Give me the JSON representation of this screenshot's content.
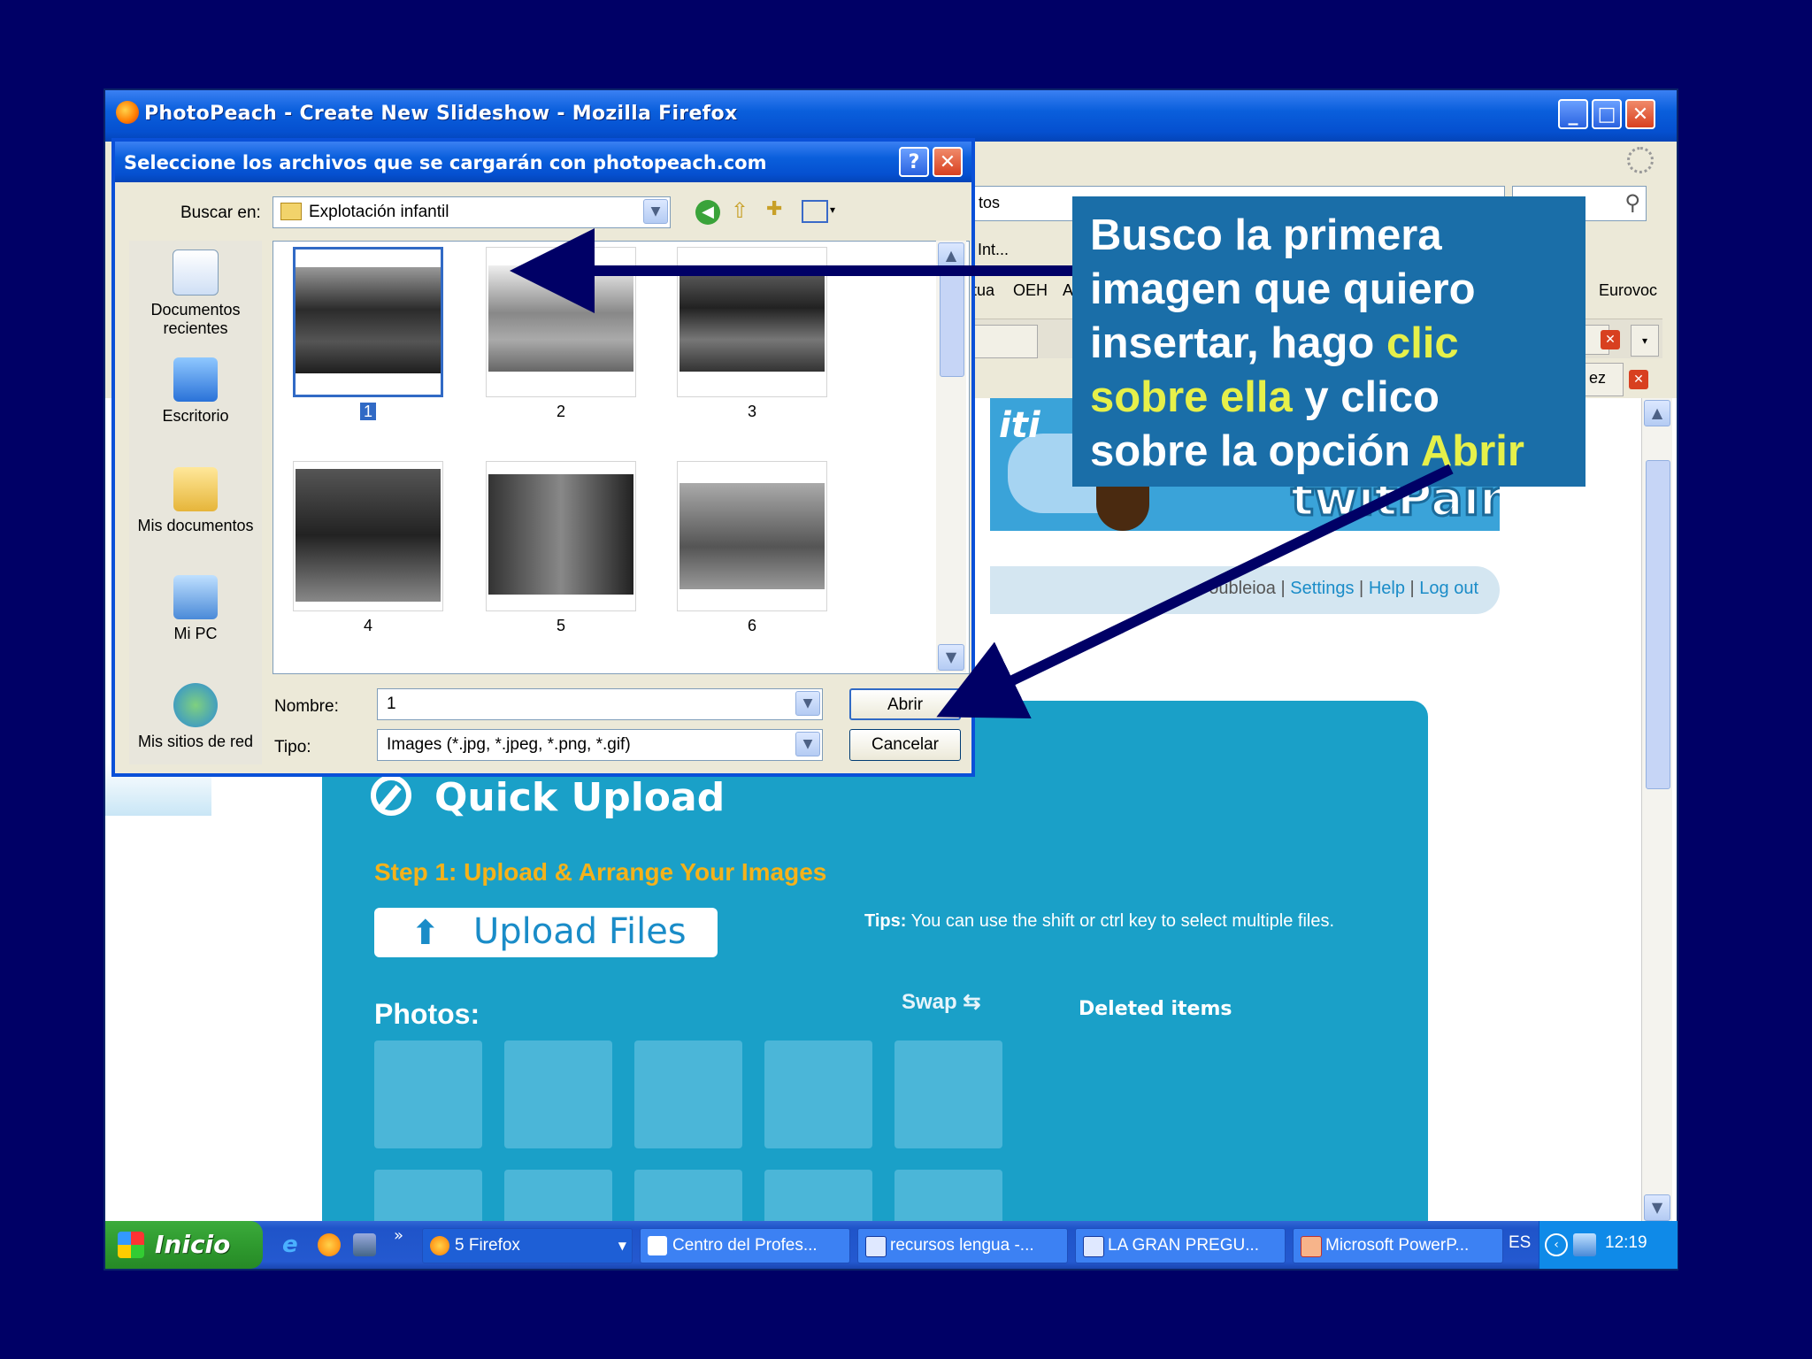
{
  "firefox": {
    "title": "PhotoPeach - Create New Slideshow - Mozilla Firefox",
    "bookmark_partial_1": "tos",
    "bookmark_partial_2": "Int...",
    "bookmark_partial_3": "tua",
    "bookmark_partial_4": "OEH",
    "bookmark_partial_5": "A",
    "bookmark_eurovoc": "Eurovoc",
    "tab_partial": "ez"
  },
  "page": {
    "banner_logo": "twitPaint",
    "nav_user": "oubleioa",
    "nav_links": [
      "Settings",
      "Help",
      "Log out"
    ],
    "quick_upload": "Quick Upload",
    "step1": "Step 1: Upload & Arrange Your Images",
    "upload_button": "Upload Files",
    "tips_label": "Tips:",
    "tips_text": "You can use the shift or ctrl key to select multiple files.",
    "photos_label": "Photos:",
    "swap": "Swap",
    "deleted_items": "Deleted items"
  },
  "dialog": {
    "title": "Seleccione los archivos que se cargarán con photopeach.com",
    "lookin_label": "Buscar en:",
    "lookin_value": "Explotación infantil",
    "places": [
      "Documentos recientes",
      "Escritorio",
      "Mis documentos",
      "Mi PC",
      "Mis sitios de red"
    ],
    "files": [
      "1",
      "2",
      "3",
      "4",
      "5",
      "6"
    ],
    "selected_file": "1",
    "name_label": "Nombre:",
    "name_value": "1",
    "type_label": "Tipo:",
    "type_value": "Images (*.jpg, *.jpeg, *.png, *.gif)",
    "open_button": "Abrir",
    "cancel_button": "Cancelar"
  },
  "annotation": {
    "line1": "Busco la primera",
    "line2": "imagen que quiero",
    "line3a": "insertar, hago ",
    "line3b": "clic",
    "line4a": "sobre ella",
    "line4b": " y clico",
    "line5a": "sobre la opción ",
    "line5b": "Abrir",
    "highlight_color": "#e6f04a",
    "box_color": "#1a6ea8",
    "arrow_color": "#000066"
  },
  "taskbar": {
    "start": "Inicio",
    "tasks": [
      "5 Firefox",
      "Centro del Profes...",
      "recursos lengua -...",
      "LA GRAN PREGU...",
      "Microsoft PowerP..."
    ],
    "language": "ES",
    "clock": "12:19"
  }
}
